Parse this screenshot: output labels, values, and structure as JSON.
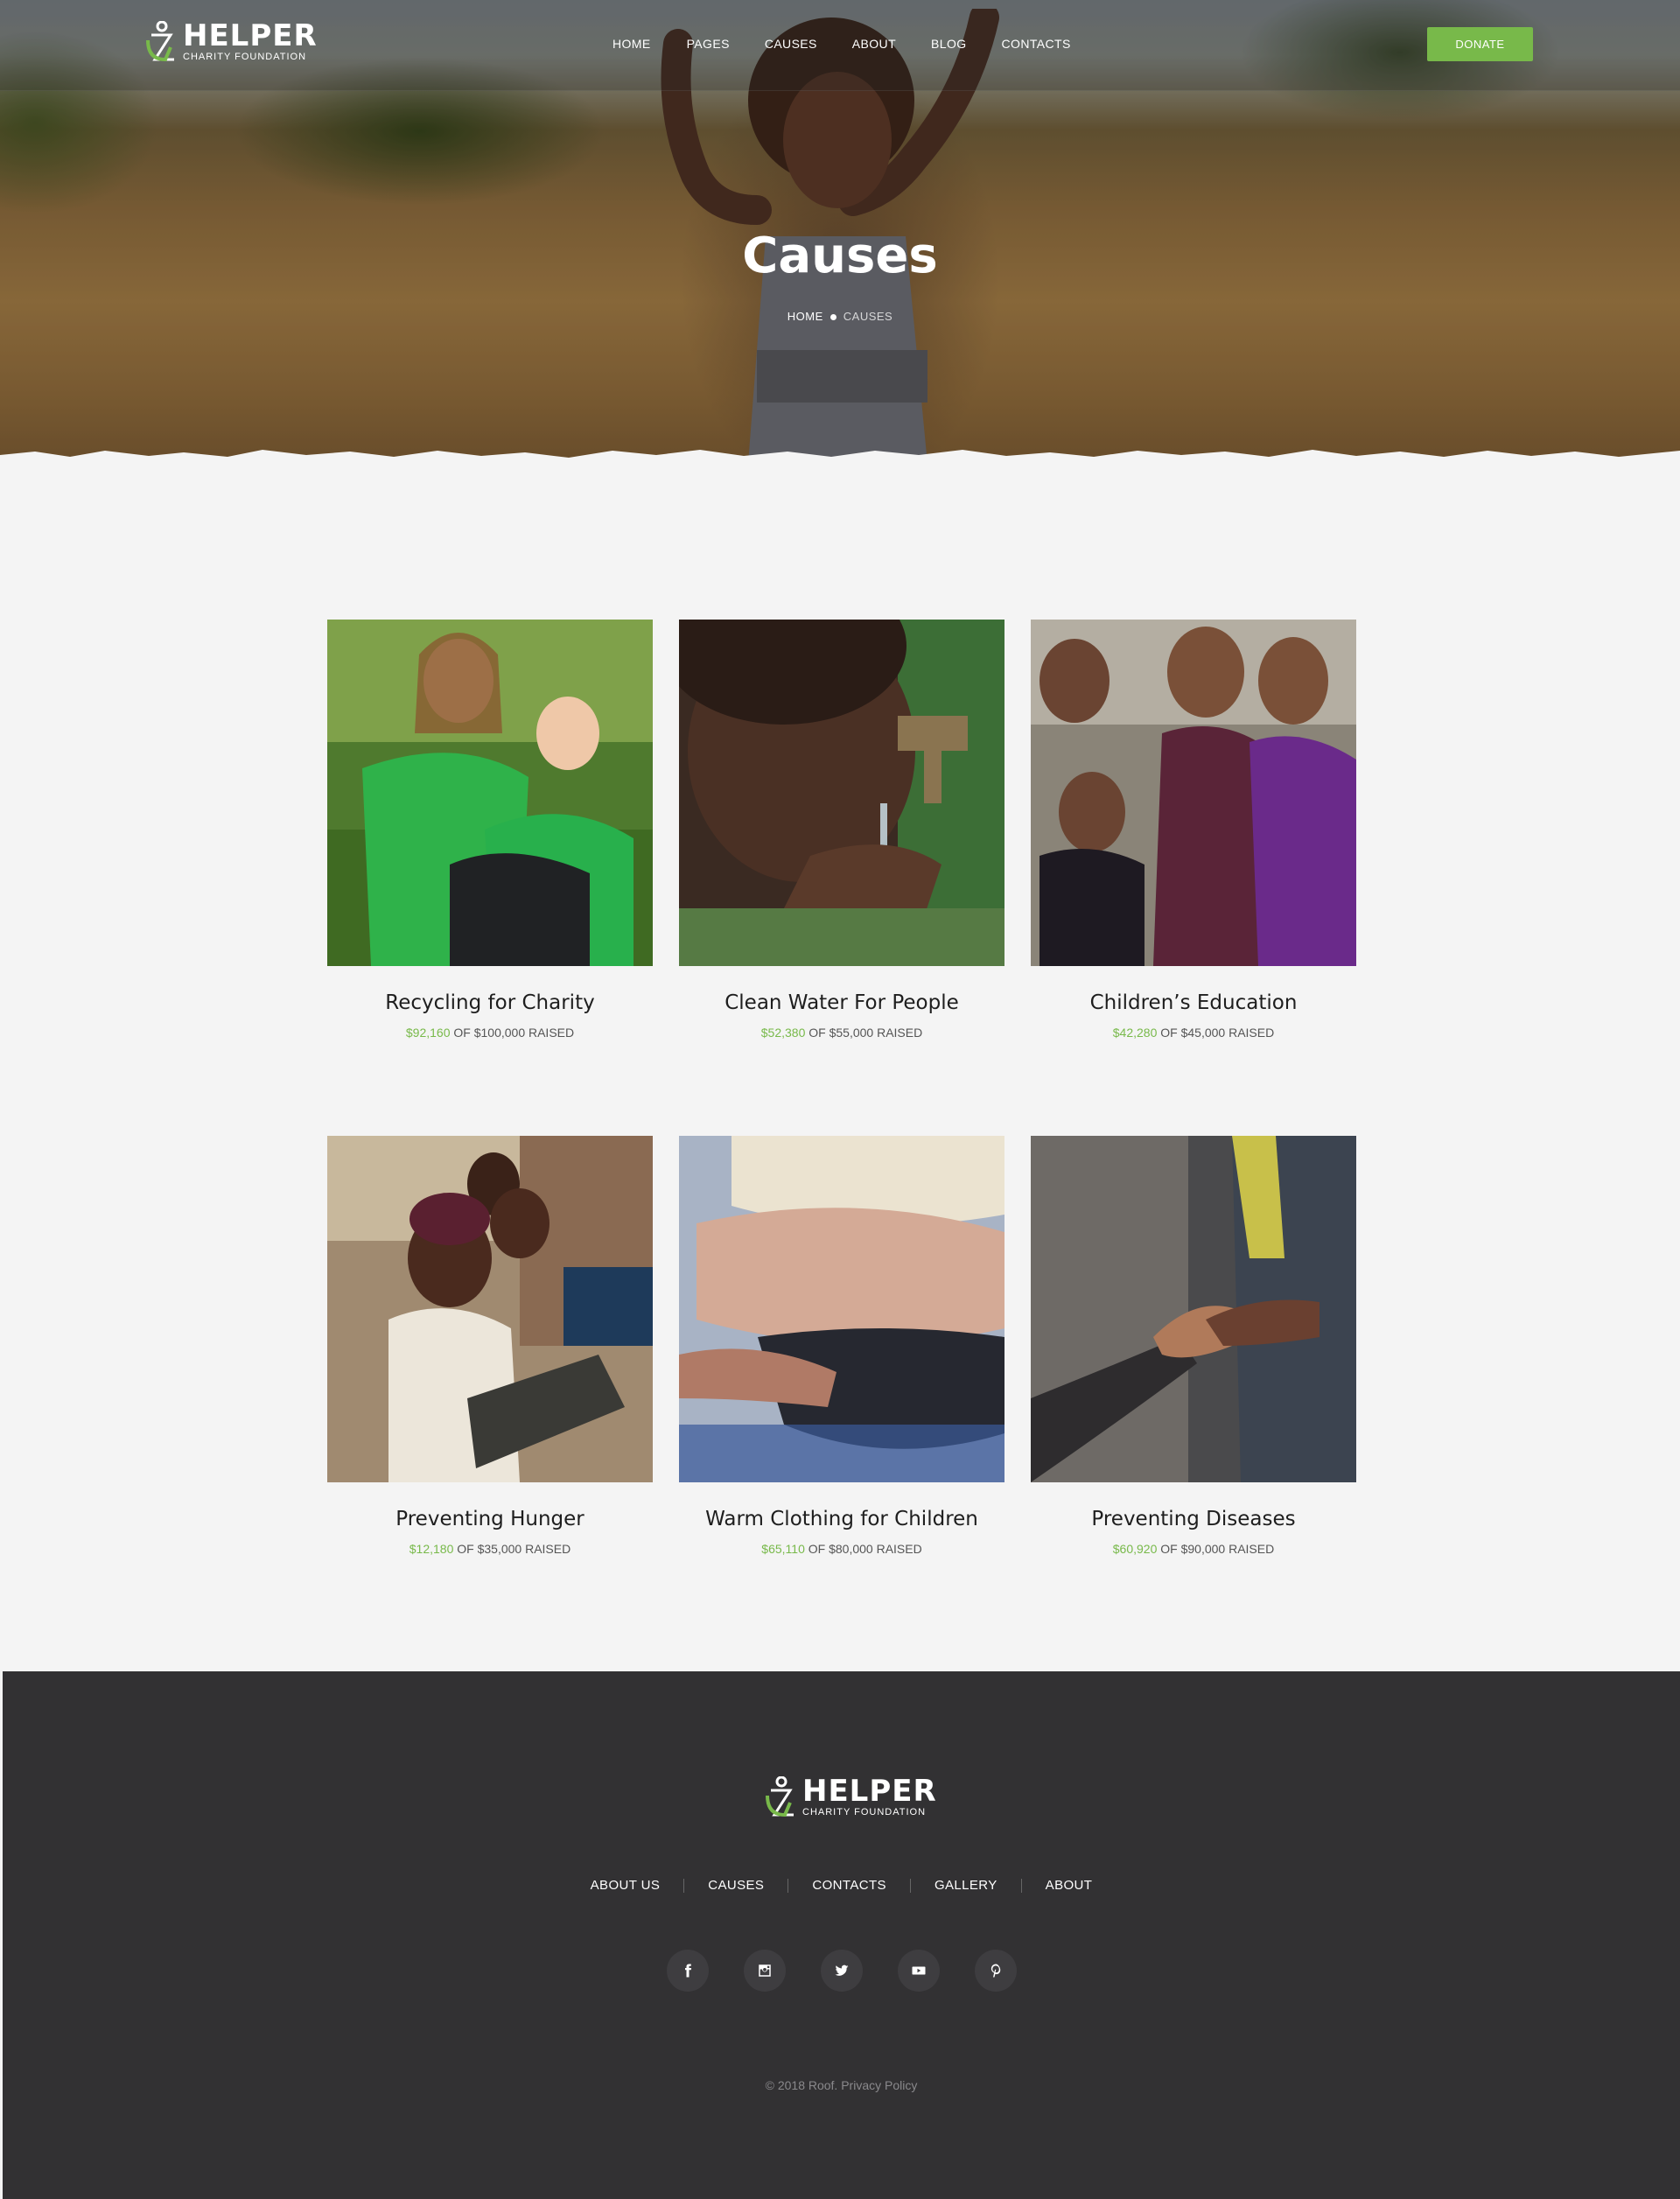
{
  "brand": {
    "name": "HELPER",
    "tagline": "CHARITY FOUNDATION"
  },
  "nav": {
    "items": [
      "HOME",
      "PAGES",
      "CAUSES",
      "ABOUT",
      "BLOG",
      "CONTACTS"
    ],
    "donate_label": "DONATE"
  },
  "hero": {
    "title": "Causes",
    "breadcrumb_home": "HOME",
    "breadcrumb_current": "CAUSES"
  },
  "causes": [
    {
      "title": "Recycling for Charity",
      "raised": "$92,160",
      "goal_text": "OF $100,000 RAISED",
      "image": "children-recycling-photo"
    },
    {
      "title": "Clean Water For People",
      "raised": "$52,380",
      "goal_text": "OF $55,000 RAISED",
      "image": "girl-drinking-water-photo"
    },
    {
      "title": "Children’s Education",
      "raised": "$42,280",
      "goal_text": "OF $45,000 RAISED",
      "image": "smiling-children-photo"
    },
    {
      "title": "Preventing Hunger",
      "raised": "$12,180",
      "goal_text": "OF $35,000 RAISED",
      "image": "child-with-slate-photo"
    },
    {
      "title": "Warm Clothing for Children",
      "raised": "$65,110",
      "goal_text": "OF $80,000 RAISED",
      "image": "knitted-sweaters-photo"
    },
    {
      "title": "Preventing Diseases",
      "raised": "$60,920",
      "goal_text": "OF $90,000 RAISED",
      "image": "hands-washing-photo"
    }
  ],
  "footer": {
    "links": [
      "ABOUT US",
      "CAUSES",
      "CONTACTS",
      "GALLERY",
      "ABOUT"
    ],
    "social": [
      "facebook-icon",
      "instagram-icon",
      "twitter-icon",
      "youtube-icon",
      "pinterest-icon"
    ],
    "copyright": "© 2018 Roof. Privacy Policy"
  },
  "colors": {
    "accent": "#78b94a",
    "footer_bg": "#323133",
    "page_bg": "#f4f4f4"
  }
}
